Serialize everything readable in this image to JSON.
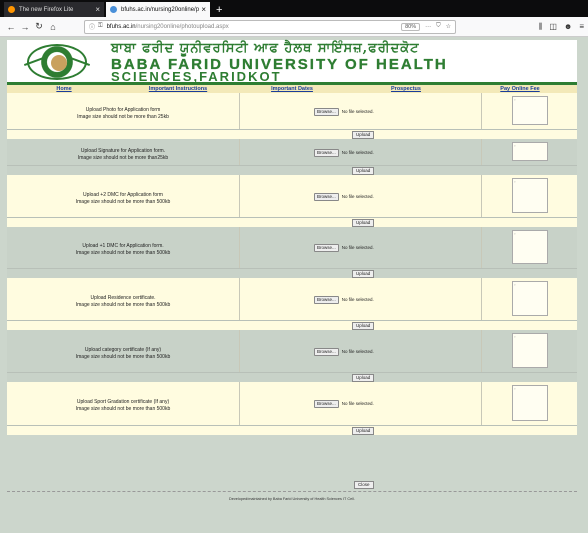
{
  "browser": {
    "tabs": [
      {
        "title": "The new Firefox Lite",
        "active": false
      },
      {
        "title": "bfuhs.ac.in/nursing20online/p",
        "active": true
      }
    ],
    "new_tab": "+",
    "url_host": "bfuhs.ac.in",
    "url_path": "/nursing20online/photoupload.aspx",
    "zoom": "80%",
    "more": "···"
  },
  "header": {
    "punjabi_title": "ਬਾਬਾ ਫਰੀਦ ਯੂਨੀਵਰਸਿਟੀ ਆਫ ਹੈਲਥ ਸਾਇੰਸਜ਼,ਫਰੀਦਕੋਟ",
    "english_line1": "BABA FARID UNIVERSITY OF HEALTH",
    "english_line2": "SCIENCES,FARIDKOT"
  },
  "menu": [
    "Home",
    "Important Instructions",
    "Important Dates",
    "Prospectus",
    "Pay Online Fee"
  ],
  "browse_label": "Browse...",
  "no_file_label": "No file selected.",
  "upload_label": "Upload",
  "close_label": "Close",
  "rows": [
    {
      "line1": "Upload Photo for Application form",
      "line2": "Image size should not be more than 25kb"
    },
    {
      "line1": "Upload Signature for Application form.",
      "line2": "Image size should not be more than25kb"
    },
    {
      "line1": "Upload +2 DMC for Application form",
      "line2": "Image size should not be more than 500kb"
    },
    {
      "line1": "Upload +1 DMC for Application form.",
      "line2": "Image size should not be more than 500kb"
    },
    {
      "line1": "Upload Residence certificate.",
      "line2": "Image size should not be more than 500kb"
    },
    {
      "line1": "Upload category certificate (If any)",
      "line2": "Image size should not be more than 500kb"
    },
    {
      "line1": "Upload Sport Gradation certificate (If any)",
      "line2": "Image size should not be more than 500kb"
    }
  ],
  "footer": "Developed/maintained by Baba Farid University of Health Sciences IT Cell."
}
